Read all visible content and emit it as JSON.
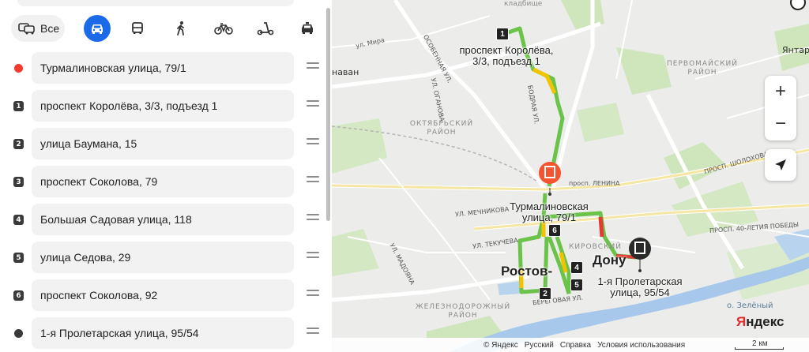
{
  "transport_modes": {
    "all_label": "Все",
    "items": [
      {
        "name": "car",
        "active": true
      },
      {
        "name": "bus",
        "active": false
      },
      {
        "name": "walk",
        "active": false
      },
      {
        "name": "bike",
        "active": false
      },
      {
        "name": "scooter",
        "active": false
      },
      {
        "name": "taxi",
        "active": false
      }
    ]
  },
  "route_points": [
    {
      "marker": "",
      "marker_type": "start",
      "address": "Турмалиновская улица, 79/1"
    },
    {
      "marker": "1",
      "marker_type": "number",
      "address": "проспект Королёва, 3/3, подъезд 1"
    },
    {
      "marker": "2",
      "marker_type": "number",
      "address": "улица Баумана, 15"
    },
    {
      "marker": "3",
      "marker_type": "number",
      "address": "проспект Соколова, 79"
    },
    {
      "marker": "4",
      "marker_type": "number",
      "address": "Большая Садовая улица, 118"
    },
    {
      "marker": "5",
      "marker_type": "number",
      "address": "улица Седова, 29"
    },
    {
      "marker": "6",
      "marker_type": "number",
      "address": "проспект Соколова, 92"
    },
    {
      "marker": "",
      "marker_type": "end",
      "address": "1-я Пролетарская улица, 95/54"
    }
  ],
  "map": {
    "districts": {
      "pervomaisky": "ПЕРВОМАЙСКИЙ\nРАЙОН",
      "oktyabrsky": "ОКТЯБРЬСКИЙ\nРАЙОН",
      "kirovsky": "КИРОВСКИЙ",
      "zheleznodorozhny": "ЖЕЛЕЗНОДОРОЖНЫЙ\nРАЙОН"
    },
    "cemetery": "кладбище",
    "place_left": "наван",
    "place_right": "Янтар",
    "island": "о. Зелёный",
    "streets": {
      "mira": "ул. Мира",
      "osoben": "ОСОБЕННАЯ УЛ.",
      "oganova": "УЛ. ОГАНОВА",
      "bodraya": "БОДРАЯ УЛ.",
      "lenina": "просп. ЛЕНИНА",
      "shol": "ПРОСП. ШОЛОХОВА",
      "mechn": "УЛ. МЕЧНИКОВА",
      "tekuch": "УЛ. ТЕКУЧЕВА",
      "madoyana": "УЛ. МАДОЯНА",
      "octyabrya": "ПРОСП. 40-ЛЕТИЯ ПОБЕДЫ",
      "beregovaya": "БЕРЕГОВАЯ УЛ."
    },
    "label_point_1": "проспект Королёва,\n3/3, подъезд 1",
    "label_start": "Турмалиновская\nулица, 79/1",
    "label_end": "1-я Пролетарская\nулица, 95/54",
    "city": "Ростов-на-Дону",
    "city_visible": "Ростов-",
    "city_visible_tail": "Дону",
    "sq_markers": [
      "1",
      "2",
      "4",
      "5",
      "6"
    ],
    "zoom_in": "+",
    "zoom_out": "−"
  },
  "footer": {
    "copyright": "© Яндекс",
    "language": "Русский",
    "help": "Справка",
    "terms": "Условия использования",
    "scale": "2 км"
  },
  "logo": {
    "first": "Я",
    "rest": "ндекс"
  },
  "colors": {
    "accent": "#1b6ae8",
    "start": "#f43a2c",
    "route_good": "#3cbf2f",
    "route_mid": "#f2c400",
    "route_bad": "#e53935"
  }
}
